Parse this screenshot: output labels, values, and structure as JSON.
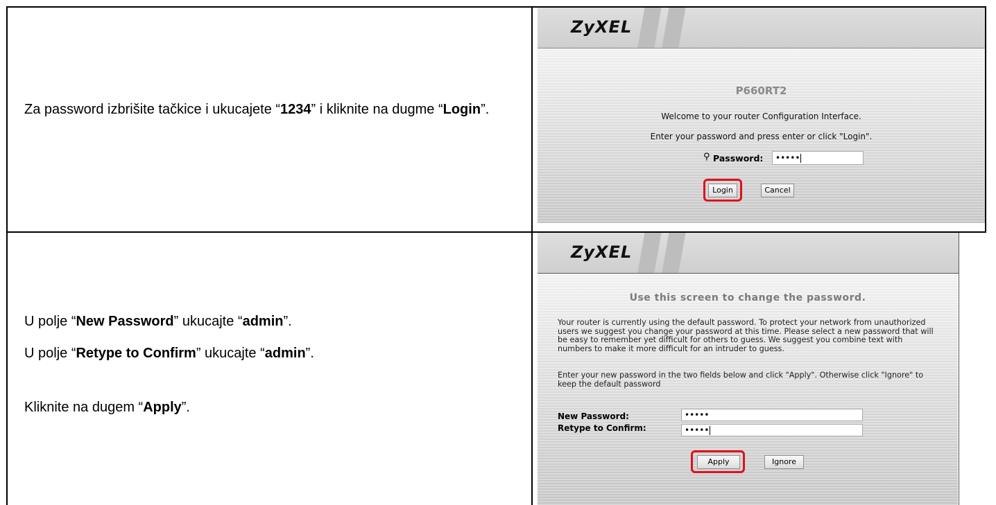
{
  "rows": [
    {
      "instruction": {
        "prefix": "Za password izbrišite tačkice i ukucajete “",
        "value": "1234",
        "mid": "” i kliknite na dugme “",
        "button": "Login",
        "suffix": "”."
      },
      "screenshot": {
        "logo": "ZyXEL",
        "model": "P660RT2",
        "welcome": "Welcome to your router Configuration Interface.",
        "hint": "Enter your password and press enter or click \"Login\".",
        "password_label": "Password:",
        "password_value": "•••••",
        "login_label": "Login",
        "cancel_label": "Cancel",
        "highlight_color": "#e0101b"
      }
    },
    {
      "instruction": {
        "line1_prefix": "U polje “",
        "line1_field": "New Password",
        "line1_mid": "” ukucajte “",
        "line1_value": "admin",
        "line1_suffix": "”.",
        "line2_prefix": "U polje “",
        "line2_field": "Retype to Confirm",
        "line2_mid": "” ukucajte “",
        "line2_value": "admin",
        "line2_suffix": "”.",
        "line3_prefix": "Kliknite na dugem “",
        "line3_button": "Apply",
        "line3_suffix": "”."
      },
      "screenshot": {
        "logo": "ZyXEL",
        "title": "Use this screen to change the password.",
        "paragraph1": "Your router is currently using the default password. To protect your network from unauthorized users we suggest you change your password at this time. Please select a new password that will be easy to remember yet difficult for others to guess.  We suggest you combine text with numbers to make it more difficult for an intruder to guess.",
        "paragraph2": "Enter your new password in the two fields below and click \"Apply\". Otherwise click \"Ignore\" to keep the default password",
        "new_password_label": "New Password:",
        "new_password_value": "•••••",
        "confirm_label": "Retype to Confirm:",
        "confirm_value": "•••••",
        "apply_label": "Apply",
        "ignore_label": "Ignore",
        "highlight_color": "#e0101b"
      }
    }
  ]
}
